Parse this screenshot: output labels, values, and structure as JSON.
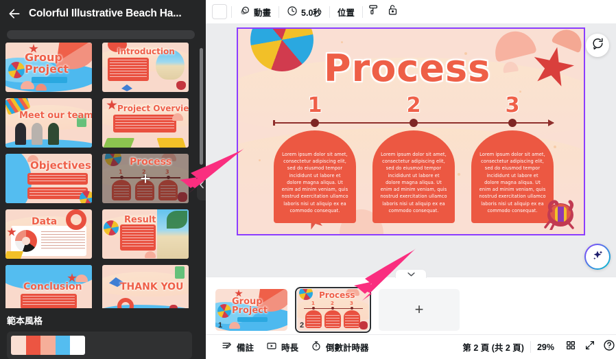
{
  "left_panel": {
    "back_icon": "back-arrow-icon",
    "title": "Colorful Illustrative Beach Ha...",
    "style_section_title": "範本風格",
    "palette_colors": [
      "#fadfd3",
      "#ec5542",
      "#f6ae99",
      "#54bdf0",
      "#ffffff"
    ],
    "templates": [
      {
        "name": "Group Project",
        "title": "Group\nProject",
        "kind": "cover"
      },
      {
        "name": "Introduction",
        "title": "Introduction",
        "kind": "intro"
      },
      {
        "name": "Meet our team",
        "title": "Meet our team",
        "kind": "team"
      },
      {
        "name": "Project Overview",
        "title": "Project Overview",
        "kind": "overview"
      },
      {
        "name": "Objectives",
        "title": "Objectives",
        "kind": "objectives"
      },
      {
        "name": "Process",
        "title": "Process",
        "kind": "process",
        "hovered": true
      },
      {
        "name": "Data",
        "title": "Data",
        "kind": "data"
      },
      {
        "name": "Result",
        "title": "Result",
        "kind": "result"
      },
      {
        "name": "Conclusion",
        "title": "Conclusion",
        "kind": "conclusion"
      },
      {
        "name": "Thank You",
        "title": "THANK YOU",
        "kind": "thanks"
      }
    ]
  },
  "toolbar": {
    "color_swatch": "#fadfd3",
    "animate_label": "動畫",
    "animate_icon": "animate-icon",
    "duration_label": "5.0秒",
    "duration_icon": "clock-icon",
    "position_label": "位置",
    "paint_roller_icon": "paint-roller-icon",
    "lock_icon": "unlock-icon"
  },
  "canvas": {
    "selection_color": "#8b3dff",
    "comment_icon": "add-comment-icon",
    "magic_icon": "magic-sparkle-icon",
    "slide": {
      "background": "#fadfd3",
      "title": "Process",
      "steps": [
        {
          "number": "1",
          "body": "Lorem ipsum dolor sit amet, consectetur adipiscing elit, sed do eiusmod tempor incididunt ut labore et dolore magna aliqua. Ut enim ad minim veniam, quis nostrud exercitation ullamco laboris nisi ut aliquip ex ea commodo consequat."
        },
        {
          "number": "2",
          "body": "Lorem ipsum dolor sit amet, consectetur adipiscing elit, sed do eiusmod tempor incididunt ut labore et dolore magna aliqua. Ut enim ad minim veniam, quis nostrud exercitation ullamco laboris nisi ut aliquip ex ea commodo consequat."
        },
        {
          "number": "3",
          "body": "Lorem ipsum dolor sit amet, consectetur adipiscing elit, sed do eiusmod tempor incididunt ut labore et dolore magna aliqua. Ut enim ad minim veniam, quis nostrud exercitation ullamco laboris nisi ut aliquip ex ea commodo consequat."
        }
      ]
    }
  },
  "filmstrip": {
    "collapse_icon": "chevron-down-icon",
    "add_slide_label": "+",
    "slides": [
      {
        "number": "1",
        "title": "Group\nProject",
        "kind": "cover",
        "selected": false
      },
      {
        "number": "2",
        "title": "Process",
        "kind": "process",
        "selected": true
      }
    ]
  },
  "statusbar": {
    "notes_label": "備註",
    "notes_icon": "notes-icon",
    "duration_label": "時長",
    "duration_icon": "timeline-icon",
    "timer_label": "倒數計時器",
    "timer_icon": "stopwatch-icon",
    "page_indicator": "第 2 頁 (共 2 頁)",
    "zoom_level": "29%",
    "grid_icon": "grid-view-icon",
    "fullscreen_icon": "fullscreen-icon",
    "help_icon": "help-icon"
  }
}
